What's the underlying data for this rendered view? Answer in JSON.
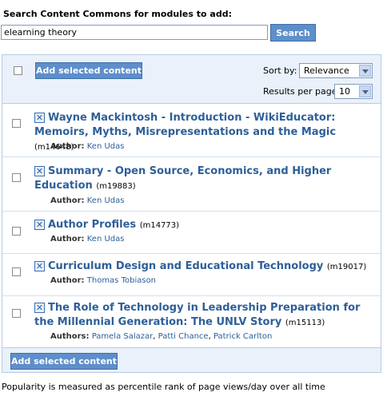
{
  "search": {
    "label": "Search Content Commons for modules to add:",
    "query": "elearning theory",
    "button_label": "Search"
  },
  "toolbar": {
    "add_label": "Add selected content",
    "sort_label": "Sort by:",
    "sort_value": "Relevance",
    "rpp_label": "Results per page:",
    "rpp_value": "10"
  },
  "results": [
    {
      "title": "Wayne Mackintosh - Introduction - WikiEducator: Memoirs, Myths, Misrepresentations and the Magic",
      "id": "(m14648)",
      "author_label": "Author:",
      "authors": [
        "Ken Udas"
      ]
    },
    {
      "title": "Summary - Open Source, Economics, and Higher Education",
      "id": "(m19883)",
      "author_label": "Author:",
      "authors": [
        "Ken Udas"
      ]
    },
    {
      "title": "Author Profiles",
      "id": "(m14773)",
      "author_label": "Author:",
      "authors": [
        "Ken Udas"
      ]
    },
    {
      "title": "Curriculum Design and Educational Technology",
      "id": "(m19017)",
      "author_label": "Author:",
      "authors": [
        "Thomas Tobiason"
      ]
    },
    {
      "title": "The Role of Technology in Leadership Preparation for the Millennial Generation: The UNLV Story",
      "id": "(m15113)",
      "author_label": "Authors:",
      "authors": [
        "Pamela Salazar",
        "Patti Chance",
        "Patrick Carlton"
      ]
    }
  ],
  "footer": {
    "add_label": "Add selected content",
    "note": "Popularity is measured as percentile rank of page views/day over all time"
  },
  "colors": {
    "accent": "#5e8fcb",
    "link": "#2d5f99",
    "panel_bg": "#eaf1fa"
  },
  "icons": {
    "module": "module-x-icon"
  }
}
